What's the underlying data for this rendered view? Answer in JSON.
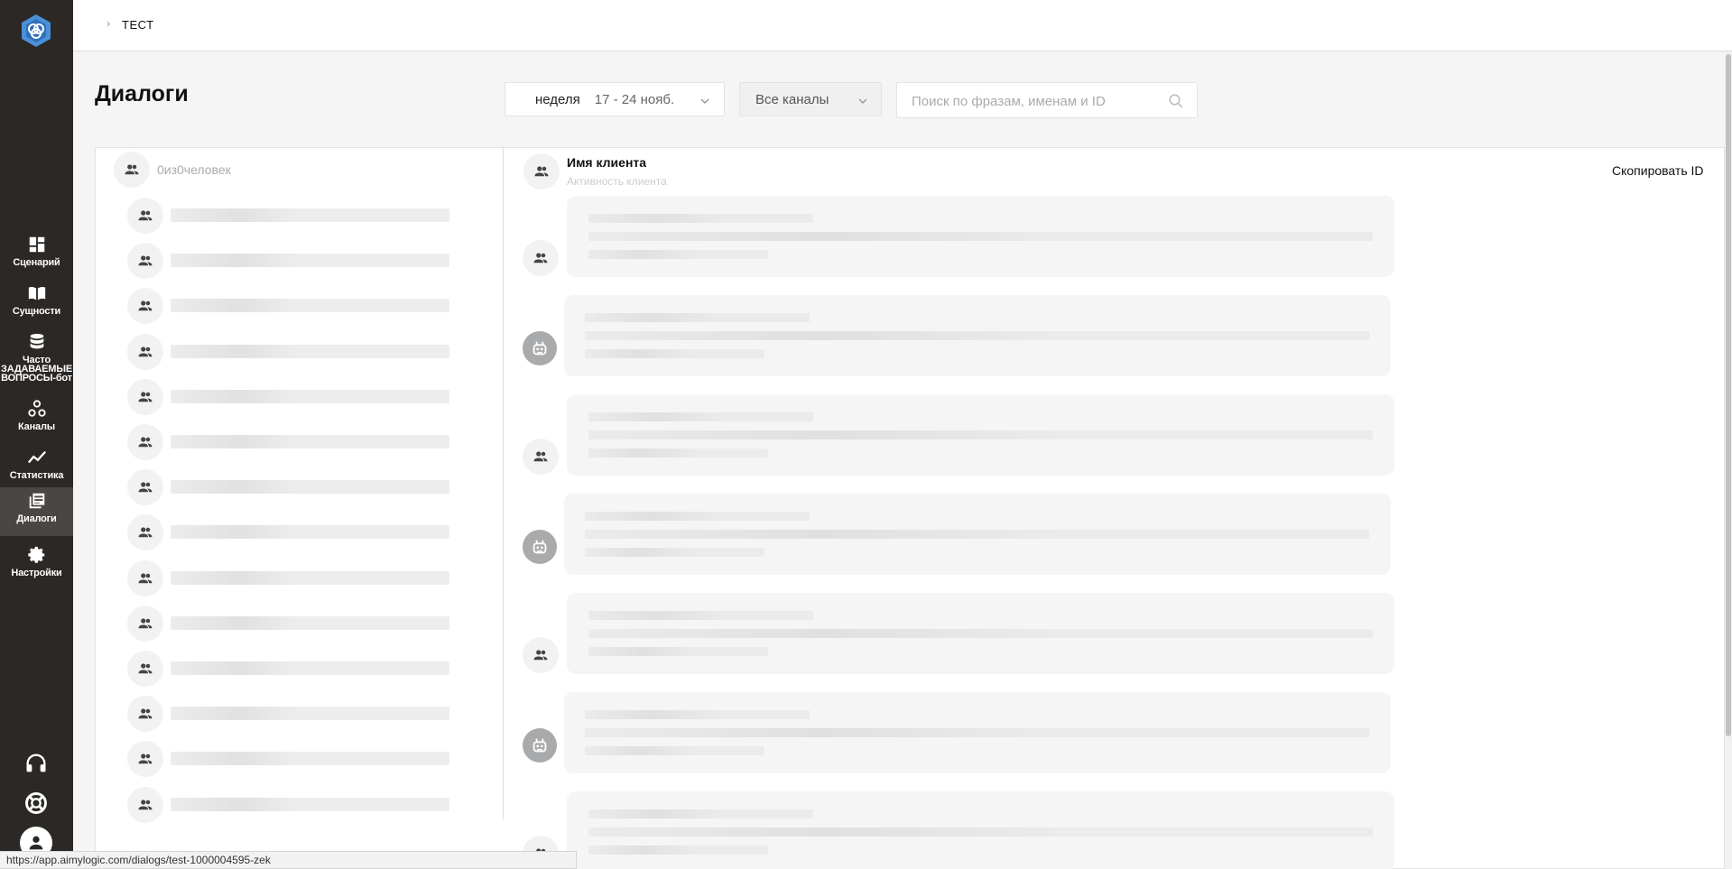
{
  "breadcrumb": {
    "item": "ТЕСТ"
  },
  "sidebar": {
    "items": [
      {
        "label": "Сценарий",
        "icon": "dashboard-icon"
      },
      {
        "label": "Сущности",
        "icon": "book-icon"
      },
      {
        "label": "Часто ЗАДАВАЕМЫЕ ВОПРОСЫ-бот",
        "icon": "database-icon"
      },
      {
        "label": "Каналы",
        "icon": "channels-icon"
      },
      {
        "label": "Статистика",
        "icon": "chart-icon"
      },
      {
        "label": "Диалоги",
        "icon": "dialogs-icon",
        "active": true
      },
      {
        "label": "Настройки",
        "icon": "gear-icon"
      }
    ]
  },
  "header": {
    "title": "Диалоги",
    "period": {
      "label": "неделя",
      "range": "17 - 24 нояб."
    },
    "channels": {
      "label": "Все каналы"
    },
    "search": {
      "placeholder": "Поиск по фразам, именам и ID"
    }
  },
  "list": {
    "count_text": "0из0человек"
  },
  "chat": {
    "client_name": "Имя клиента",
    "client_activity": "Активность клиента",
    "copy_id": "Скопировать ID"
  },
  "status_url": "https://app.aimylogic.com/dialogs/test-1000004595-zek"
}
